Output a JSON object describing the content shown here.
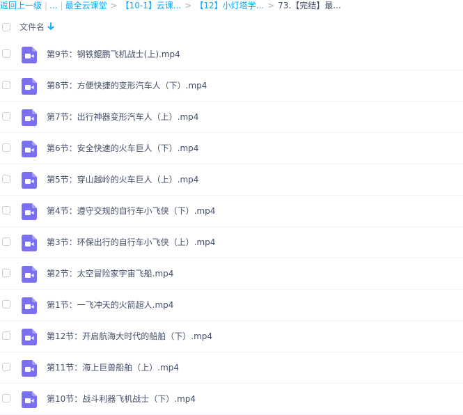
{
  "breadcrumb": {
    "back": "返回上一级",
    "ellipsis": "...",
    "items": [
      "最全云课堂",
      "【10-1】云课...",
      "【12】小灯塔学...",
      "73.【完结】最..."
    ]
  },
  "header": {
    "name_label": "文件名",
    "sort_icon": "arrow-down-icon"
  },
  "colors": {
    "link": "#06a7ff",
    "icon_bg": "#7a6ff0",
    "text": "#424e67"
  },
  "files": [
    {
      "name": "第9节：钢铁鲲鹏飞机战士(上).mp4",
      "icon": "video-file-icon"
    },
    {
      "name": "第8节：方便快捷的变形汽车人（下）.mp4",
      "icon": "video-file-icon"
    },
    {
      "name": "第7节：出行神器变形汽车人（上）.mp4",
      "icon": "video-file-icon"
    },
    {
      "name": "第6节：安全快速的火车巨人（下）.mp4",
      "icon": "video-file-icon"
    },
    {
      "name": "第5节：穿山越岭的火车巨人（上）.mp4",
      "icon": "video-file-icon"
    },
    {
      "name": "第4节：遵守交规的自行车小飞侠（下）.mp4",
      "icon": "video-file-icon"
    },
    {
      "name": "第3节：环保出行的自行车小飞侠（上）.mp4",
      "icon": "video-file-icon"
    },
    {
      "name": "第2节：太空冒险家宇宙飞船.mp4",
      "icon": "video-file-icon"
    },
    {
      "name": "第1节：一飞冲天的火箭超人.mp4",
      "icon": "video-file-icon"
    },
    {
      "name": "第12节：开启航海大时代的船舶（下）.mp4",
      "icon": "video-file-icon"
    },
    {
      "name": "第11节：海上巨兽船舶（上）.mp4",
      "icon": "video-file-icon"
    },
    {
      "name": "第10节：战斗利器飞机战士（下）.mp4",
      "icon": "video-file-icon"
    }
  ]
}
